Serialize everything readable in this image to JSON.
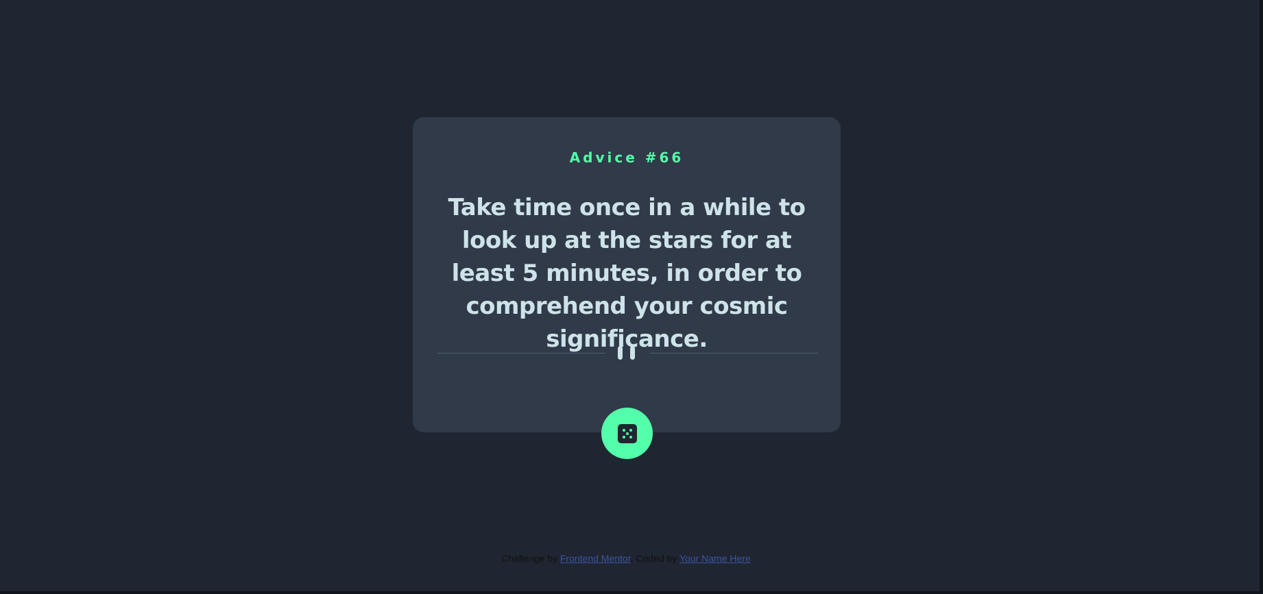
{
  "advice": {
    "id_label": "Advice #66",
    "text": "Take time once in a while to look up at the stars for at least 5 minutes, in order to comprehend your cosmic significance."
  },
  "divider": {
    "icon": "pause-icon"
  },
  "dice_button": {
    "icon": "dice-icon"
  },
  "footer": {
    "prefix": "Challenge by",
    "challenge_link": "Frontend Mentor",
    "middle": ". Coded by",
    "author_link": "Your Name Here"
  },
  "colors": {
    "background": "#1f2631",
    "card": "#313a48",
    "accent": "#53ffaa",
    "text": "#cee3e9",
    "divider": "#4f5d74",
    "link": "#3e52a3"
  }
}
